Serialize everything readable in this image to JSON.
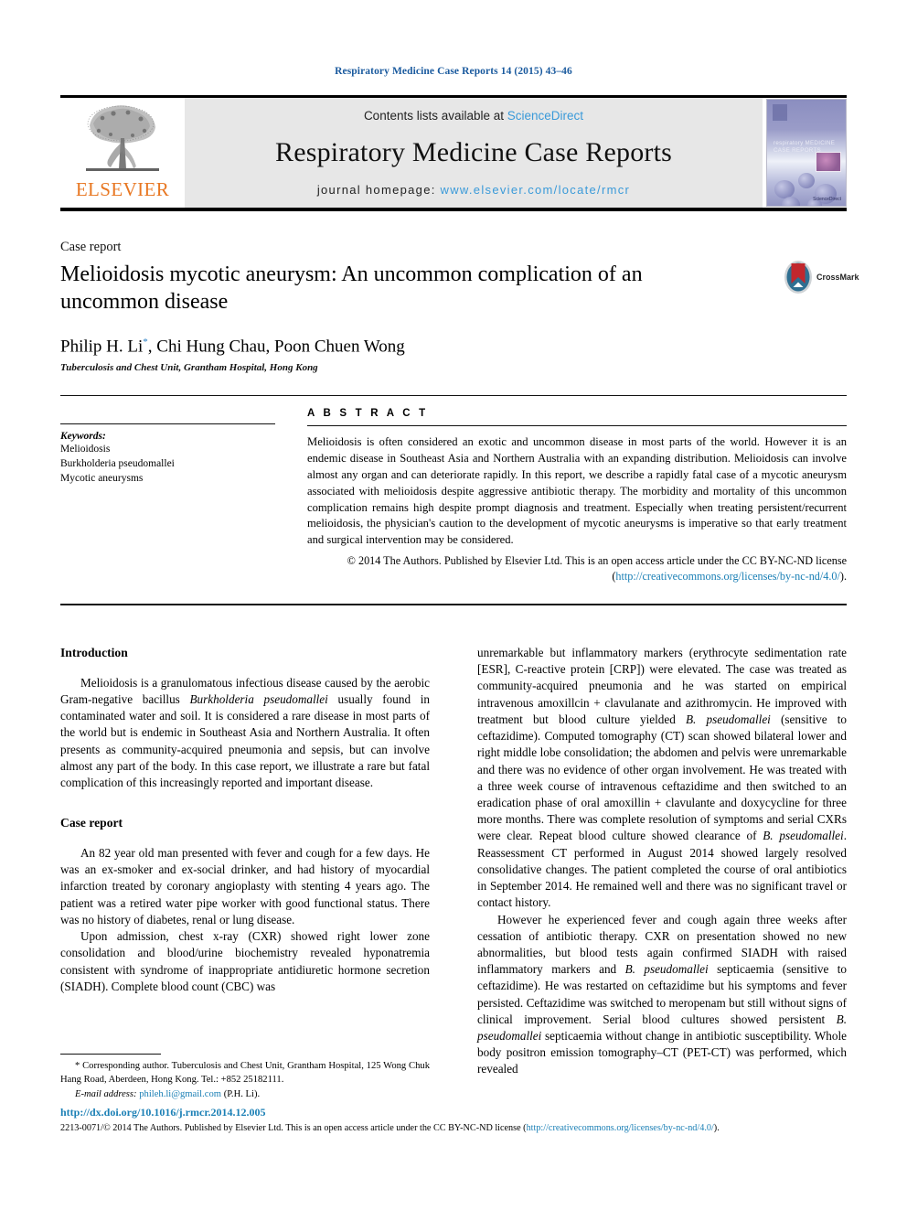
{
  "running_head": "Respiratory Medicine Case Reports 14 (2015) 43–46",
  "masthead": {
    "publisher": "ELSEVIER",
    "contents_prefix": "Contents lists available at ",
    "contents_link": "ScienceDirect",
    "journal_title": "Respiratory Medicine Case Reports",
    "homepage_label": "journal homepage: ",
    "homepage_url": "www.elsevier.com/locate/rmcr",
    "cover": {
      "title_line1": "respiratory MEDICINE",
      "title_line2": "CASE REPORTS",
      "foot": "ScienceDirect"
    }
  },
  "article": {
    "type": "Case report",
    "title": "Melioidosis mycotic aneurysm: An uncommon complication of an uncommon disease",
    "authors": "Philip H. Li",
    "authors_rest": ", Chi Hung Chau, Poon Chuen Wong",
    "corresponding_marker": "*",
    "affiliation": "Tuberculosis and Chest Unit, Grantham Hospital, Hong Kong",
    "crossmark_label": "CrossMark"
  },
  "keywords": {
    "heading": "Keywords:",
    "items": [
      "Melioidosis",
      "Burkholderia pseudomallei",
      "Mycotic aneurysms"
    ]
  },
  "abstract": {
    "heading": "A B S T R A C T",
    "text": "Melioidosis is often considered an exotic and uncommon disease in most parts of the world. However it is an endemic disease in Southeast Asia and Northern Australia with an expanding distribution. Melioidosis can involve almost any organ and can deteriorate rapidly. In this report, we describe a rapidly fatal case of a mycotic aneurysm associated with melioidosis despite aggressive antibiotic therapy. The morbidity and mortality of this uncommon complication remains high despite prompt diagnosis and treatment. Especially when treating persistent/recurrent melioidosis, the physician's caution to the development of mycotic aneurysms is imperative so that early treatment and surgical intervention may be considered.",
    "copyright_before": "© 2014 The Authors. Published by Elsevier Ltd. This is an open access article under the CC BY-NC-ND license (",
    "copyright_link": "http://creativecommons.org/licenses/by-nc-nd/4.0/",
    "copyright_after": ")."
  },
  "body": {
    "left": {
      "intro_heading": "Introduction",
      "intro_p1_a": "Melioidosis is a granulomatous infectious disease caused by the aerobic Gram-negative bacillus ",
      "intro_p1_italic": "Burkholderia pseudomallei",
      "intro_p1_b": " usually found in contaminated water and soil. It is considered a rare disease in most parts of the world but is endemic in Southeast Asia and Northern Australia. It often presents as community-acquired pneumonia and sepsis, but can involve almost any part of the body. In this case report, we illustrate a rare but fatal complication of this increasingly reported and important disease.",
      "case_heading": "Case report",
      "case_p1": "An 82 year old man presented with fever and cough for a few days. He was an ex-smoker and ex-social drinker, and had history of myocardial infarction treated by coronary angioplasty with stenting 4 years ago. The patient was a retired water pipe worker with good functional status. There was no history of diabetes, renal or lung disease.",
      "case_p2": "Upon admission, chest x-ray (CXR) showed right lower zone consolidation and blood/urine biochemistry revealed hyponatremia consistent with syndrome of inappropriate antidiuretic hormone secretion (SIADH). Complete blood count (CBC) was"
    },
    "right": {
      "p1_a": "unremarkable but inflammatory markers (erythrocyte sedimentation rate [ESR], C-reactive protein [CRP]) were elevated. The case was treated as community-acquired pneumonia and he was started on empirical intravenous amoxillcin + clavulanate and azithromycin. He improved with treatment but blood culture yielded ",
      "p1_italic": "B. pseudomallei",
      "p1_b": " (sensitive to ceftazidime). Computed tomography (CT) scan showed bilateral lower and right middle lobe consolidation; the abdomen and pelvis were unremarkable and there was no evidence of other organ involvement. He was treated with a three week course of intravenous ceftazidime and then switched to an eradication phase of oral amoxillin + clavulante and doxycycline for three more months. There was complete resolution of symptoms and serial CXRs were clear. Repeat blood culture showed clearance of ",
      "p1_italic2": "B. pseudomallei",
      "p1_c": ". Reassessment CT performed in August 2014 showed largely resolved consolidative changes. The patient completed the course of oral antibiotics in September 2014. He remained well and there was no significant travel or contact history.",
      "p2_a": "However he experienced fever and cough again three weeks after cessation of antibiotic therapy. CXR on presentation showed no new abnormalities, but blood tests again confirmed SIADH with raised inflammatory markers and ",
      "p2_italic": "B. pseudomallei",
      "p2_b": " septicaemia (sensitive to ceftazidime). He was restarted on ceftazidime but his symptoms and fever persisted. Ceftazidime was switched to meropenam but still without signs of clinical improvement. Serial blood cultures showed persistent ",
      "p2_italic2": "B. pseudomallei",
      "p2_c": " septicaemia without change in antibiotic susceptibility. Whole body positron emission tomography–CT (PET-CT) was performed, which revealed"
    }
  },
  "footnotes": {
    "corresponding": "* Corresponding author. Tuberculosis and Chest Unit, Grantham Hospital, 125 Wong Chuk Hang Road, Aberdeen, Hong Kong. Tel.: +852 25182111.",
    "email_label": "E-mail address:",
    "email": "phileh.li@gmail.com",
    "email_owner": "(P.H. Li)."
  },
  "footer": {
    "doi": "http://dx.doi.org/10.1016/j.rmcr.2014.12.005",
    "issn_copyright_before": "2213-0071/© 2014 The Authors. Published by Elsevier Ltd. This is an open access article under the CC BY-NC-ND license (",
    "issn_copyright_link": "http://creativecommons.org/licenses/by-nc-nd/4.0/",
    "issn_copyright_after": ")."
  },
  "colors": {
    "link": "#1a7fb5",
    "running_head": "#1a5a9e",
    "elsevier_orange": "#E87722",
    "sciencedirect": "#3a9ad9"
  }
}
